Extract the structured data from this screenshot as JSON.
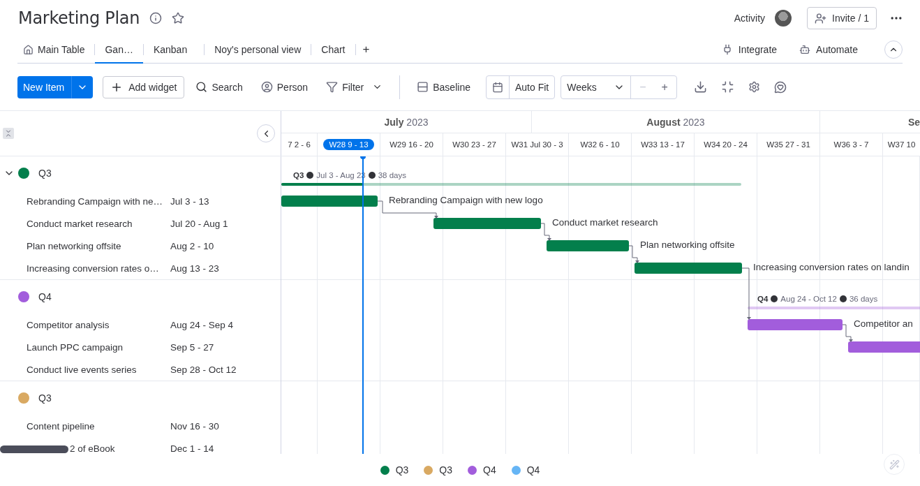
{
  "board": {
    "title": "Marketing Plan"
  },
  "header_actions": {
    "activity": "Activity",
    "invite": "Invite / 1"
  },
  "view_tabs": [
    {
      "label": "Main Table",
      "selected": false
    },
    {
      "label": "Gan…",
      "selected": true
    },
    {
      "label": "Kanban",
      "selected": false
    },
    {
      "label": "Noy's personal view",
      "selected": false
    },
    {
      "label": "Chart",
      "selected": false
    }
  ],
  "add_tab": "+",
  "view_actions": [
    "Integrate",
    "Automate"
  ],
  "toolbar": {
    "new_item": "New Item",
    "add_widget": "Add widget",
    "search": "Search",
    "person": "Person",
    "filter": "Filter",
    "baseline": "Baseline",
    "auto_fit": "Auto Fit",
    "scale": "Weeks",
    "zoom_out": "−",
    "zoom_in": "+"
  },
  "timeline": {
    "months": [
      "**July** 2023",
      "**August** 2023",
      "**Se**"
    ],
    "weeks": [
      {
        "label": "7 2 - 6",
        "selected": false
      },
      {
        "label": "W28 9 - 13",
        "selected": true
      },
      {
        "label": "W29 16 - 20",
        "selected": false
      },
      {
        "label": "W30 23 - 27",
        "selected": false
      },
      {
        "label": "W31 Jul 30 - 3",
        "selected": false
      },
      {
        "label": "W32 6 - 10",
        "selected": false
      },
      {
        "label": "W33 13 - 17",
        "selected": false
      },
      {
        "label": "W34 20 - 24",
        "selected": false
      },
      {
        "label": "W35 27 - 31",
        "selected": false
      },
      {
        "label": "W36 3 - 7",
        "selected": false
      },
      {
        "label": "W37 10",
        "selected": false
      }
    ]
  },
  "groups": [
    {
      "name": "Q3",
      "color": "#037f4c",
      "hovered": true,
      "summary": {
        "name": "Q3",
        "dates": "Jul 3 - Aug 23",
        "duration": "38 days"
      },
      "items": [
        {
          "name": "Rebranding Campaign with ne…",
          "dates": "Jul 3 - 13",
          "bar_label": "Rebranding Campaign with new logo"
        },
        {
          "name": "Conduct market research",
          "dates": "Jul 20 - Aug 1",
          "bar_label": "Conduct market research"
        },
        {
          "name": "Plan networking offsite",
          "dates": "Aug 2 - 10",
          "bar_label": "Plan networking offsite"
        },
        {
          "name": "Increasing conversion rates o…",
          "dates": "Aug 13 - 23",
          "bar_label": "Increasing conversion rates on landin"
        }
      ]
    },
    {
      "name": "Q4",
      "color": "#a25ddc",
      "hovered": false,
      "summary": {
        "name": "Q4",
        "dates": "Aug 24 - Oct 12",
        "duration": "36 days"
      },
      "items": [
        {
          "name": "Competitor analysis",
          "dates": "Aug 24 - Sep 4",
          "bar_label": "Competitor an"
        },
        {
          "name": "Launch PPC campaign",
          "dates": "Sep 5 - 27"
        },
        {
          "name": "Conduct live events series",
          "dates": "Sep 28 - Oct 12"
        }
      ]
    },
    {
      "name": "Q3",
      "color": "#d9a962",
      "hovered": false,
      "items": [
        {
          "name": "Content pipeline",
          "dates": "Nov 16 - 30"
        },
        {
          "name": "2 of eBook",
          "dates": "Dec 1 - 14",
          "kind": "covered"
        }
      ]
    }
  ],
  "legend": [
    {
      "label": "Q3",
      "color": "#037f4c"
    },
    {
      "label": "Q3",
      "color": "#d9a962"
    },
    {
      "label": "Q4",
      "color": "#a25ddc"
    },
    {
      "label": "Q4",
      "color": "#66b5f5"
    }
  ]
}
